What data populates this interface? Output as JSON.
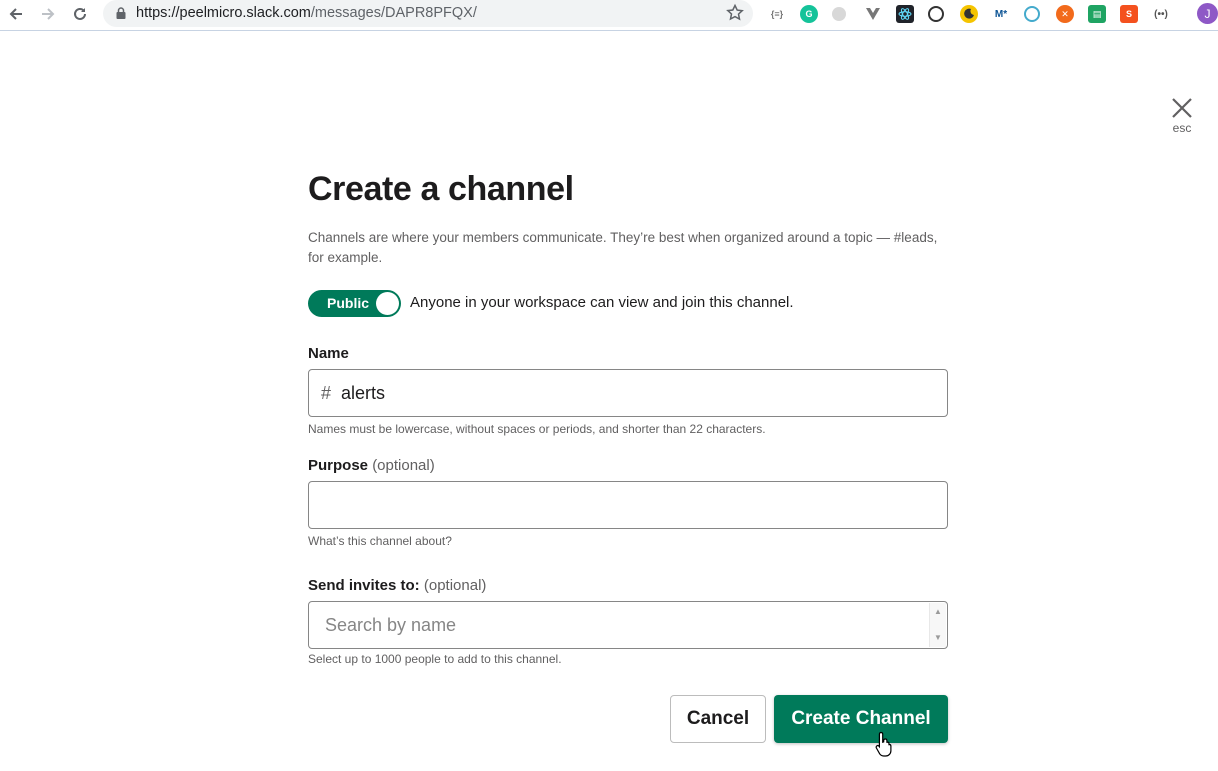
{
  "browser": {
    "url_host": "https://peelmicro.slack.com",
    "url_path": "/messages/DAPR8PFQX/",
    "profile_initial": "J",
    "extension_icons": [
      "jsonview-icon",
      "grammarly-icon",
      "extension-gray-icon",
      "vue-devtools-icon",
      "react-devtools-icon",
      "headphones-icon",
      "moon-icon",
      "movistar-icon",
      "loop-icon",
      "cross-icon",
      "sheets-icon",
      "sheet-orange-icon",
      "link-icon"
    ]
  },
  "modal": {
    "close_label": "esc",
    "title": "Create a channel",
    "description": "Channels are where your members communicate. They’re best when organized around a topic — #leads, for example.",
    "toggle_label": "Public",
    "toggle_description": "Anyone in your workspace can view and join this channel.",
    "name_label": "Name",
    "name_prefix": "#",
    "name_value": "alerts",
    "name_hint": "Names must be lowercase, without spaces or periods, and shorter than 22 characters.",
    "purpose_label": "Purpose",
    "purpose_optional": "(optional)",
    "purpose_value": "",
    "purpose_hint": "What’s this channel about?",
    "invite_label": "Send invites to:",
    "invite_optional": "(optional)",
    "invite_placeholder": "Search by name",
    "invite_hint": "Select up to 1000 people to add to this channel.",
    "cancel_label": "Cancel",
    "create_label": "Create Channel"
  },
  "colors": {
    "primary": "#007a5a",
    "text": "#1d1c1d",
    "muted": "#616061"
  }
}
